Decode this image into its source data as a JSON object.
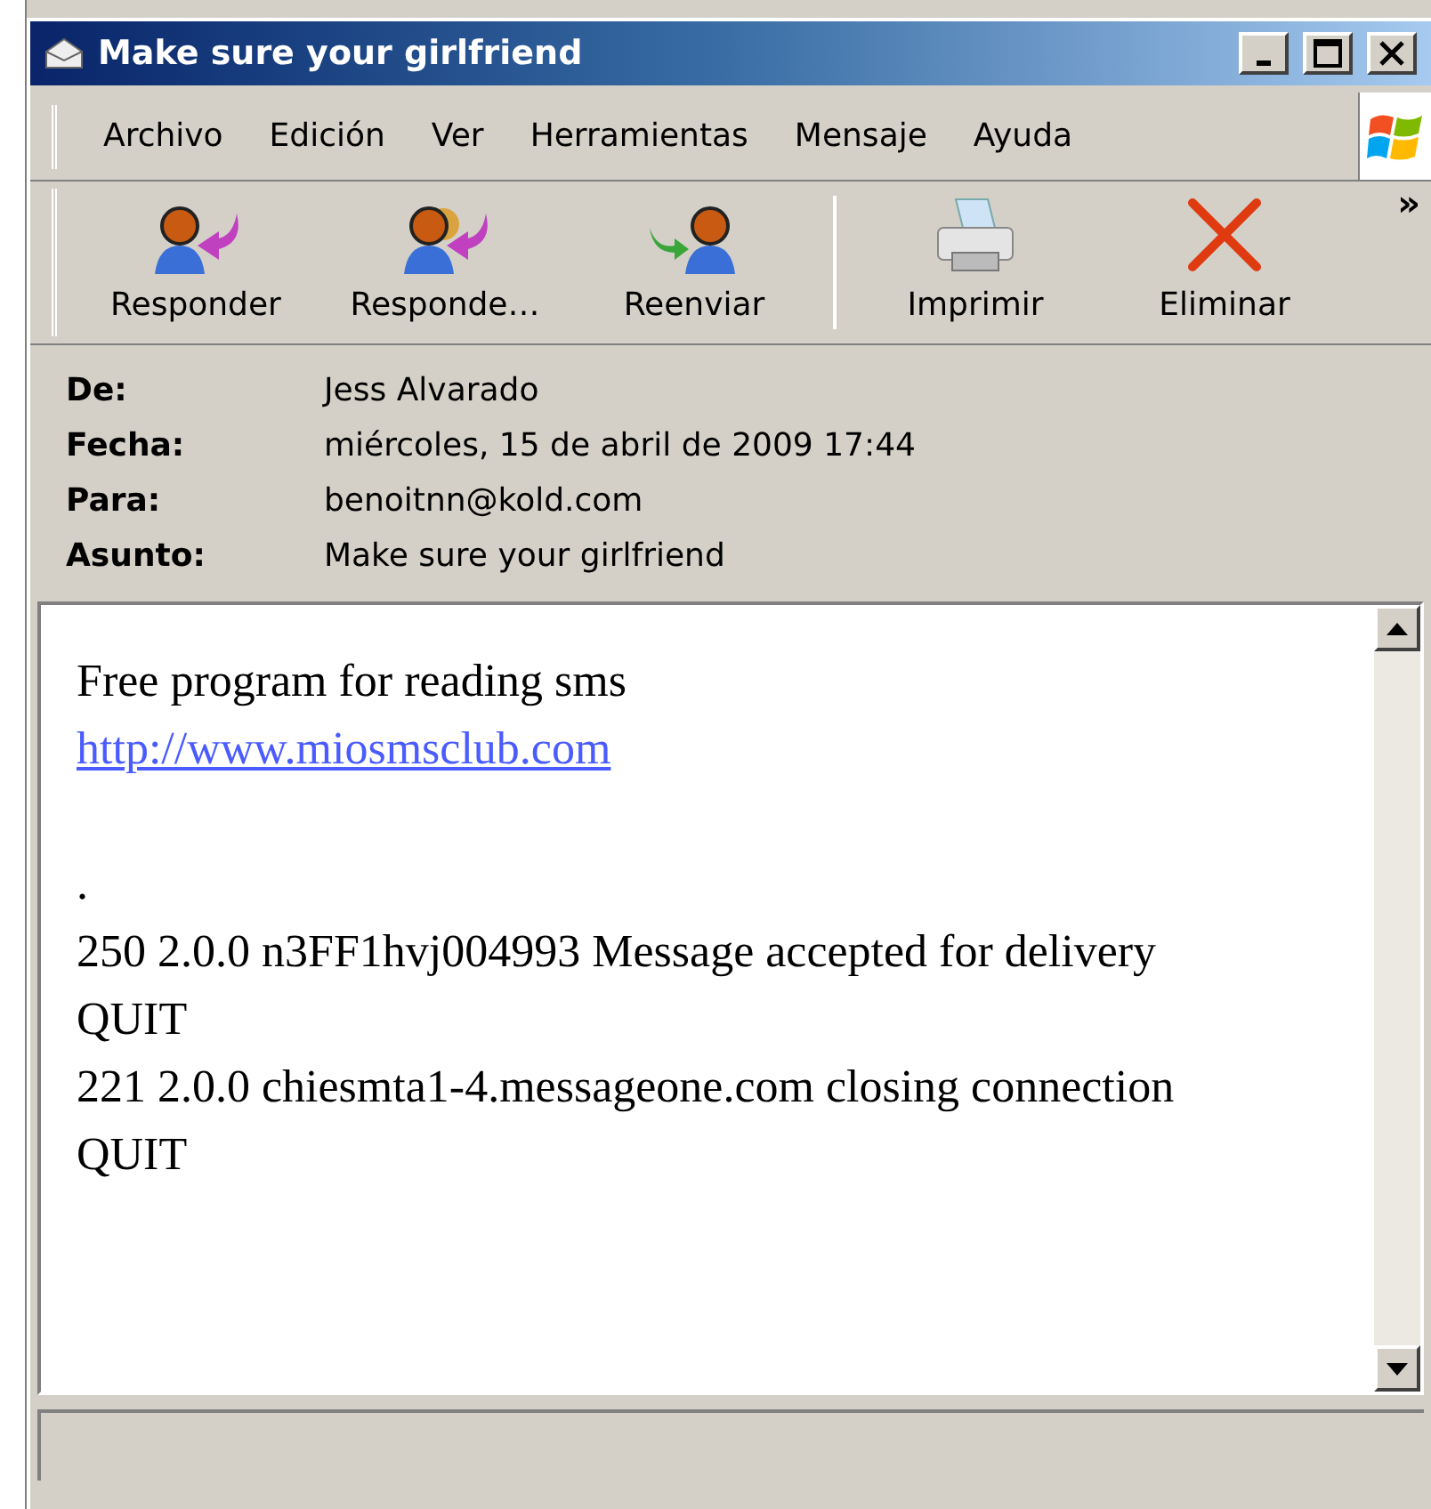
{
  "window": {
    "title": "Make sure your girlfriend"
  },
  "menu": [
    "Archivo",
    "Edición",
    "Ver",
    "Herramientas",
    "Mensaje",
    "Ayuda"
  ],
  "toolbar": [
    {
      "kind": "reply",
      "label": "Responder"
    },
    {
      "kind": "reply_all",
      "label": "Responde…"
    },
    {
      "kind": "forward",
      "label": "Reenviar"
    },
    {
      "kind": "print",
      "label": "Imprimir"
    },
    {
      "kind": "delete",
      "label": "Eliminar"
    }
  ],
  "toolbar_overflow": "»",
  "header": [
    {
      "label": "De:",
      "value": "Jess Alvarado"
    },
    {
      "label": "Fecha:",
      "value": "miércoles, 15 de abril de 2009 17:44"
    },
    {
      "label": "Para:",
      "value": "benoitnn@kold.com"
    },
    {
      "label": "Asunto:",
      "value": "Make sure your girlfriend"
    }
  ],
  "body": [
    {
      "kind": "text",
      "text": "Free program for reading sms"
    },
    {
      "kind": "link",
      "text": "http://www.miosmsclub.com"
    },
    {
      "kind": "blank"
    },
    {
      "kind": "text",
      "text": "."
    },
    {
      "kind": "text",
      "text": "250 2.0.0 n3FF1hvj004993 Message accepted for delivery"
    },
    {
      "kind": "text",
      "text": "QUIT"
    },
    {
      "kind": "text",
      "text": "221 2.0.0 chiesmta1-4.messageone.com closing connection"
    },
    {
      "kind": "text",
      "text": "QUIT"
    }
  ]
}
